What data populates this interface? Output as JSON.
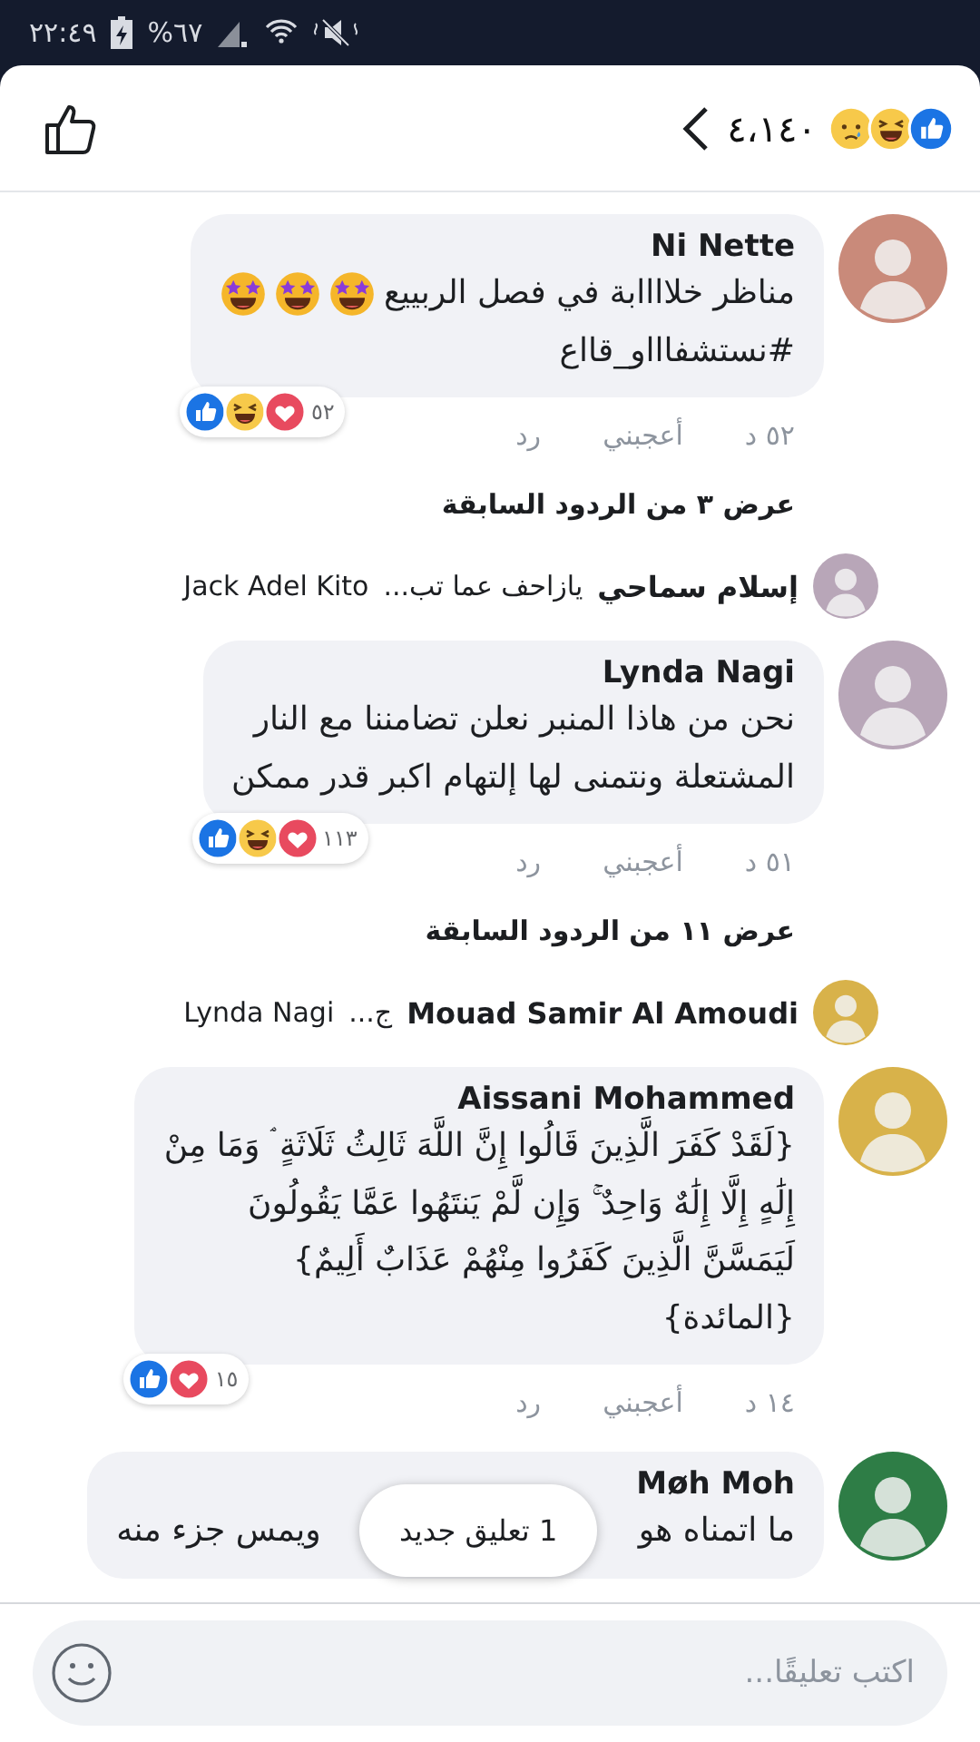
{
  "status_bar": {
    "time": "٢٢:٤٩",
    "battery": "%٦٧"
  },
  "header": {
    "reactions": [
      {
        "kind": "like"
      },
      {
        "kind": "haha"
      },
      {
        "kind": "sad"
      }
    ],
    "count": "٤،١٤٠"
  },
  "comments": [
    {
      "author": "Ni Nette",
      "text": "مناظر خلاااابة في فصل الربييع",
      "emojis": [
        {
          "kind": "star_eyes"
        },
        {
          "kind": "star_eyes"
        },
        {
          "kind": "star_eyes"
        }
      ],
      "text_2": "#نستشفاااو_قااع",
      "reactions": [
        {
          "kind": "like"
        },
        {
          "kind": "haha"
        },
        {
          "kind": "heart"
        }
      ],
      "reaction_count": "٥٢",
      "time": "٥٢ د",
      "like": "أعجبني",
      "reply": "رد",
      "more_replies": "عرض ٣ من الردود السابقة",
      "last_reply": {
        "author": "إسلام سماحي",
        "snippet": "يازاحف عما تب...",
        "mention": "Jack Adel Kito"
      }
    },
    {
      "author": "Lynda Nagi",
      "text": "نحن من هاذا المنبر نعلن تضامننا مع النار\nالمشتعلة ونتمنى لها إلتهام اكبر قدر ممكن",
      "reactions": [
        {
          "kind": "like"
        },
        {
          "kind": "haha"
        },
        {
          "kind": "heart"
        }
      ],
      "reaction_count": "١١٣",
      "time": "٥١ د",
      "like": "أعجبني",
      "reply": "رد",
      "more_replies": "عرض ١١ من الردود السابقة",
      "last_reply": {
        "author": "Mouad Samir Al Amoudi",
        "snippet": "ج...",
        "mention": "Lynda Nagi"
      }
    },
    {
      "author": "Aissani Mohammed",
      "text": "{لَقَدْ كَفَرَ الَّذِينَ قَالُوا إِنَّ اللَّهَ ثَالِثُ ثَلَاثَةٍ ۘ وَمَا مِنْ\nإِلَٰهٍ إِلَّا إِلَٰهٌ وَاحِدٌ ۚ وَإِن لَّمْ يَنتَهُوا عَمَّا يَقُولُونَ\nلَيَمَسَّنَّ الَّذِينَ كَفَرُوا مِنْهُمْ عَذَابٌ أَلِيمٌ}\n{المائدة}",
      "reactions": [
        {
          "kind": "like"
        },
        {
          "kind": "heart"
        }
      ],
      "reaction_count": "١٥",
      "time": "١٤ د",
      "like": "أعجبني",
      "reply": "رد"
    },
    {
      "author": "Møh Moh",
      "text_start": "ما اتمناه هو",
      "text_end": "ويمس جزء منه"
    }
  ],
  "toast": "1 تعليق جديد",
  "composer": {
    "placeholder": "اكتب تعليقًا..."
  }
}
